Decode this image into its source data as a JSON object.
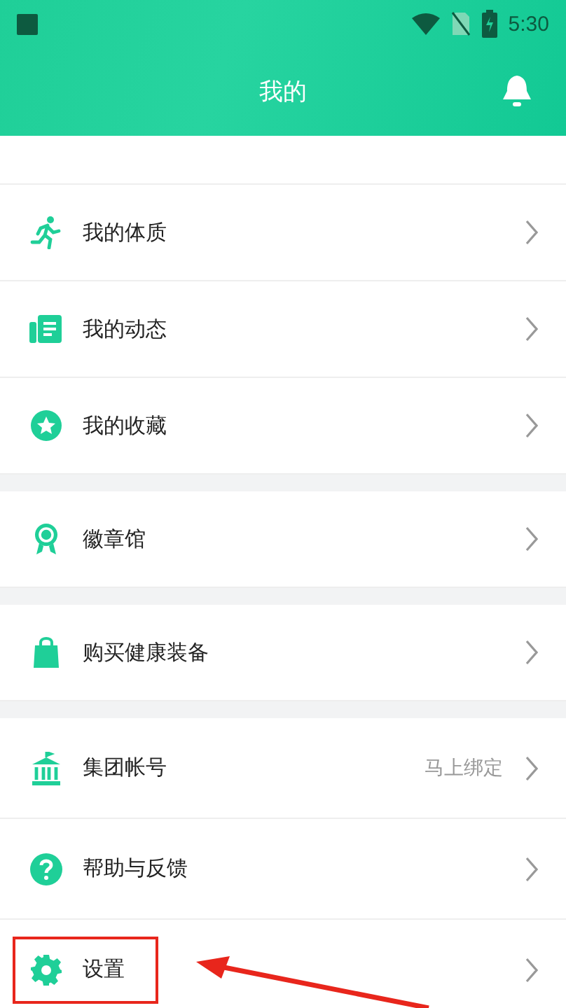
{
  "status_bar": {
    "time": "5:30"
  },
  "header": {
    "title": "我的"
  },
  "groups": [
    [
      {
        "kind": "runner",
        "label": "我的体质"
      },
      {
        "kind": "document",
        "label": "我的动态"
      },
      {
        "kind": "star",
        "label": "我的收藏"
      }
    ],
    [
      {
        "kind": "medal",
        "label": "徽章馆"
      }
    ],
    [
      {
        "kind": "bag",
        "label": "购买健康装备"
      }
    ],
    [
      {
        "kind": "building",
        "label": "集团帐号",
        "value": "马上绑定"
      },
      {
        "kind": "help",
        "label": "帮助与反馈"
      },
      {
        "kind": "gear",
        "label": "设置",
        "highlighted": true
      }
    ]
  ]
}
